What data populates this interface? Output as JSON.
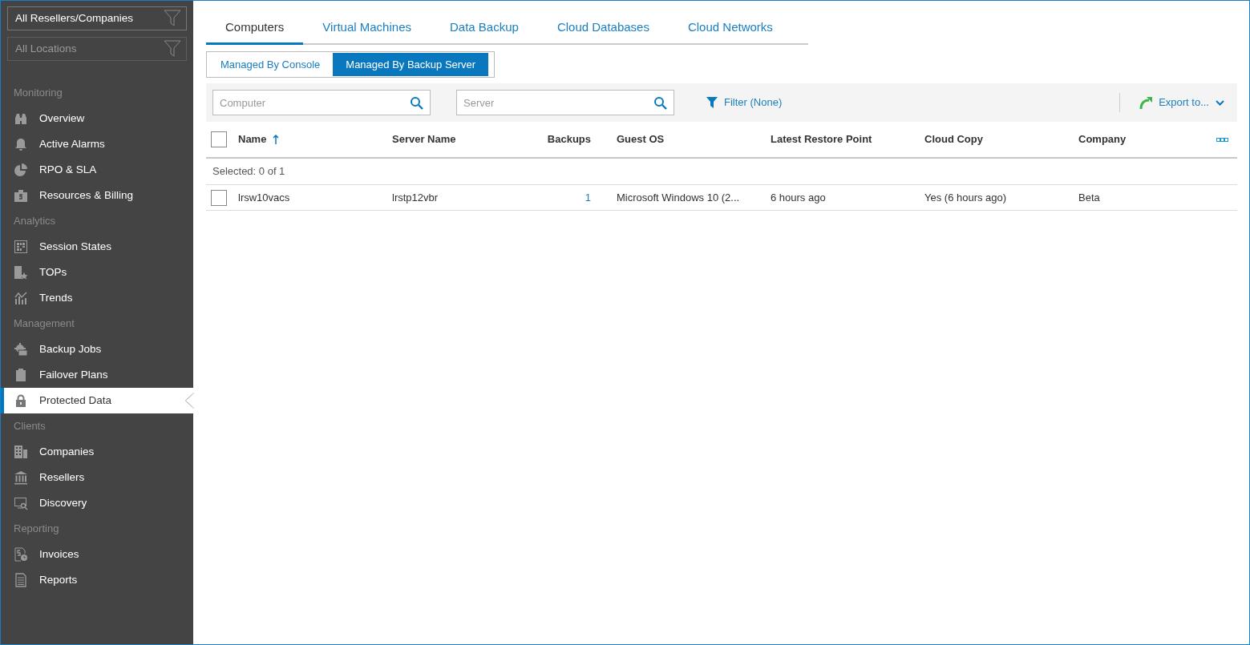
{
  "filters": [
    {
      "label": "All Resellers/Companies",
      "disabled": false
    },
    {
      "label": "All Locations",
      "disabled": true
    }
  ],
  "sidebar": {
    "sections": [
      {
        "title": "Monitoring",
        "items": [
          {
            "label": "Overview",
            "selected": false
          },
          {
            "label": "Active Alarms",
            "selected": false
          },
          {
            "label": "RPO & SLA",
            "selected": false
          },
          {
            "label": "Resources & Billing",
            "selected": false
          }
        ]
      },
      {
        "title": "Analytics",
        "items": [
          {
            "label": "Session States",
            "selected": false
          },
          {
            "label": "TOPs",
            "selected": false
          },
          {
            "label": "Trends",
            "selected": false
          }
        ]
      },
      {
        "title": "Management",
        "items": [
          {
            "label": "Backup Jobs",
            "selected": false
          },
          {
            "label": "Failover Plans",
            "selected": false
          },
          {
            "label": "Protected Data",
            "selected": true
          }
        ]
      },
      {
        "title": "Clients",
        "items": [
          {
            "label": "Companies",
            "selected": false
          },
          {
            "label": "Resellers",
            "selected": false
          },
          {
            "label": "Discovery",
            "selected": false
          }
        ]
      },
      {
        "title": "Reporting",
        "items": [
          {
            "label": "Invoices",
            "selected": false
          },
          {
            "label": "Reports",
            "selected": false
          }
        ]
      }
    ]
  },
  "tabs": [
    {
      "label": "Computers",
      "selected": true
    },
    {
      "label": "Virtual Machines",
      "selected": false
    },
    {
      "label": "Data Backup",
      "selected": false
    },
    {
      "label": "Cloud Databases",
      "selected": false
    },
    {
      "label": "Cloud Networks",
      "selected": false
    }
  ],
  "subtabs": [
    {
      "label": "Managed By Console",
      "selected": false
    },
    {
      "label": "Managed By Backup Server",
      "selected": true
    }
  ],
  "toolbar": {
    "searches": [
      {
        "placeholder": "Computer"
      },
      {
        "placeholder": "Server"
      }
    ],
    "filter": "Filter (None)",
    "export": "Export to..."
  },
  "table": {
    "select_all_checked": false,
    "columns": [
      {
        "label": "Name",
        "sorted": true,
        "link": false
      },
      {
        "label": "Server Name",
        "sorted": false,
        "link": false
      },
      {
        "label": "Backups",
        "sorted": false,
        "link": true
      },
      {
        "label": "Guest OS",
        "sorted": false,
        "link": false
      },
      {
        "label": "Latest Restore Point",
        "sorted": false,
        "link": false
      },
      {
        "label": "Cloud Copy",
        "sorted": false,
        "link": false
      },
      {
        "label": "Company",
        "sorted": false,
        "link": false
      }
    ],
    "selection_text": "Selected: 0 of 1",
    "rows": [
      {
        "checked": false,
        "cells": [
          "lrsw10vacs",
          "lrstp12vbr",
          "1",
          "Microsoft Windows 10 (2...",
          "6 hours ago",
          "Yes (6 hours ago)",
          "Beta"
        ]
      }
    ]
  }
}
